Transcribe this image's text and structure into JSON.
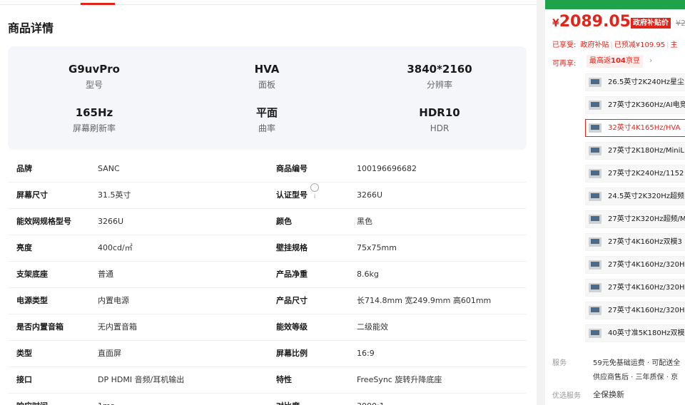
{
  "colors": {
    "accent": "#e1251b",
    "green": "#1ea24a"
  },
  "detail": {
    "section_title": "商品详情",
    "summary": [
      {
        "value": "G9uvPro",
        "key": "型号"
      },
      {
        "value": "HVA",
        "key": "面板"
      },
      {
        "value": "3840*2160",
        "key": "分辨率"
      },
      {
        "value": "165Hz",
        "key": "屏幕刷新率"
      },
      {
        "value": "平面",
        "key": "曲率"
      },
      {
        "value": "HDR10",
        "key": "HDR"
      }
    ],
    "specs": [
      {
        "k1": "品牌",
        "v1": "SANC",
        "k2": "商品编号",
        "v2": "100196696682"
      },
      {
        "k1": "屏幕尺寸",
        "v1": "31.5英寸",
        "k2": "认证型号",
        "v2": "3266U"
      },
      {
        "k1": "能效网规格型号",
        "v1": "3266U",
        "k2": "颜色",
        "v2": "黑色"
      },
      {
        "k1": "亮度",
        "v1": "400cd/㎡",
        "k2": "壁挂规格",
        "v2": "75x75mm"
      },
      {
        "k1": "支架底座",
        "v1": "普通",
        "k2": "产品净重",
        "v2": "8.6kg"
      },
      {
        "k1": "电源类型",
        "v1": "内置电源",
        "k2": "产品尺寸",
        "v2": "长714.8mm 宽249.9mm 高601mm"
      },
      {
        "k1": "是否内置音箱",
        "v1": "无内置音箱",
        "k2": "能效等级",
        "v2": "二级能效"
      },
      {
        "k1": "类型",
        "v1": "直面屏",
        "k2": "屏幕比例",
        "v2": "16:9"
      },
      {
        "k1": "接口",
        "v1": "DP HDMI 音频/耳机输出",
        "k2": "特性",
        "v2": "FreeSync 旋转升降底座"
      },
      {
        "k1": "响应时间",
        "v1": "1ms",
        "k2": "对比度",
        "v2": "3000:1"
      }
    ],
    "info_icon": "i"
  },
  "buybox": {
    "currency": "¥",
    "price": "2089.05",
    "subsidy_badge": "政府补贴价",
    "old_price": "¥2",
    "enjoy_label": "已享受:",
    "enjoy_items": [
      "政府补贴",
      "已预减¥109.95"
    ],
    "enjoy_sep": "|",
    "enjoy_more": "主",
    "again_label": "可再享:",
    "beans_prefix": "最高返",
    "beans_num": "104",
    "beans_suffix": "京豆",
    "chevron": "›",
    "variants": [
      {
        "label": "26.5英寸2K240Hz星尘",
        "selected": false
      },
      {
        "label": "27英寸2K360Hz/AI电竞",
        "selected": false
      },
      {
        "label": "32英寸4K165Hz/HVA",
        "selected": true
      },
      {
        "label": "27英寸2K180Hz/MiniL",
        "selected": false
      },
      {
        "label": "27英寸2K240Hz/1152",
        "selected": false
      },
      {
        "label": "24.5英寸2K320Hz超频",
        "selected": false
      },
      {
        "label": "27英寸2K320Hz超频/M",
        "selected": false
      },
      {
        "label": "27英寸4K160Hz双模3",
        "selected": false
      },
      {
        "label": "27英寸4K160Hz/320H",
        "selected": false
      },
      {
        "label": "27英寸4K160Hz/320H",
        "selected": false
      },
      {
        "label": "27英寸4K160Hz/320H",
        "selected": false
      },
      {
        "label": "40英寸准5K180Hz双模",
        "selected": false
      }
    ],
    "service_label": "服务",
    "service_line1": "59元免基础运费 · 可配送全",
    "service_line2": "供应商售后 · 三年质保 · 京",
    "optional_label": "优选服务",
    "optional_item": "全保换新"
  }
}
